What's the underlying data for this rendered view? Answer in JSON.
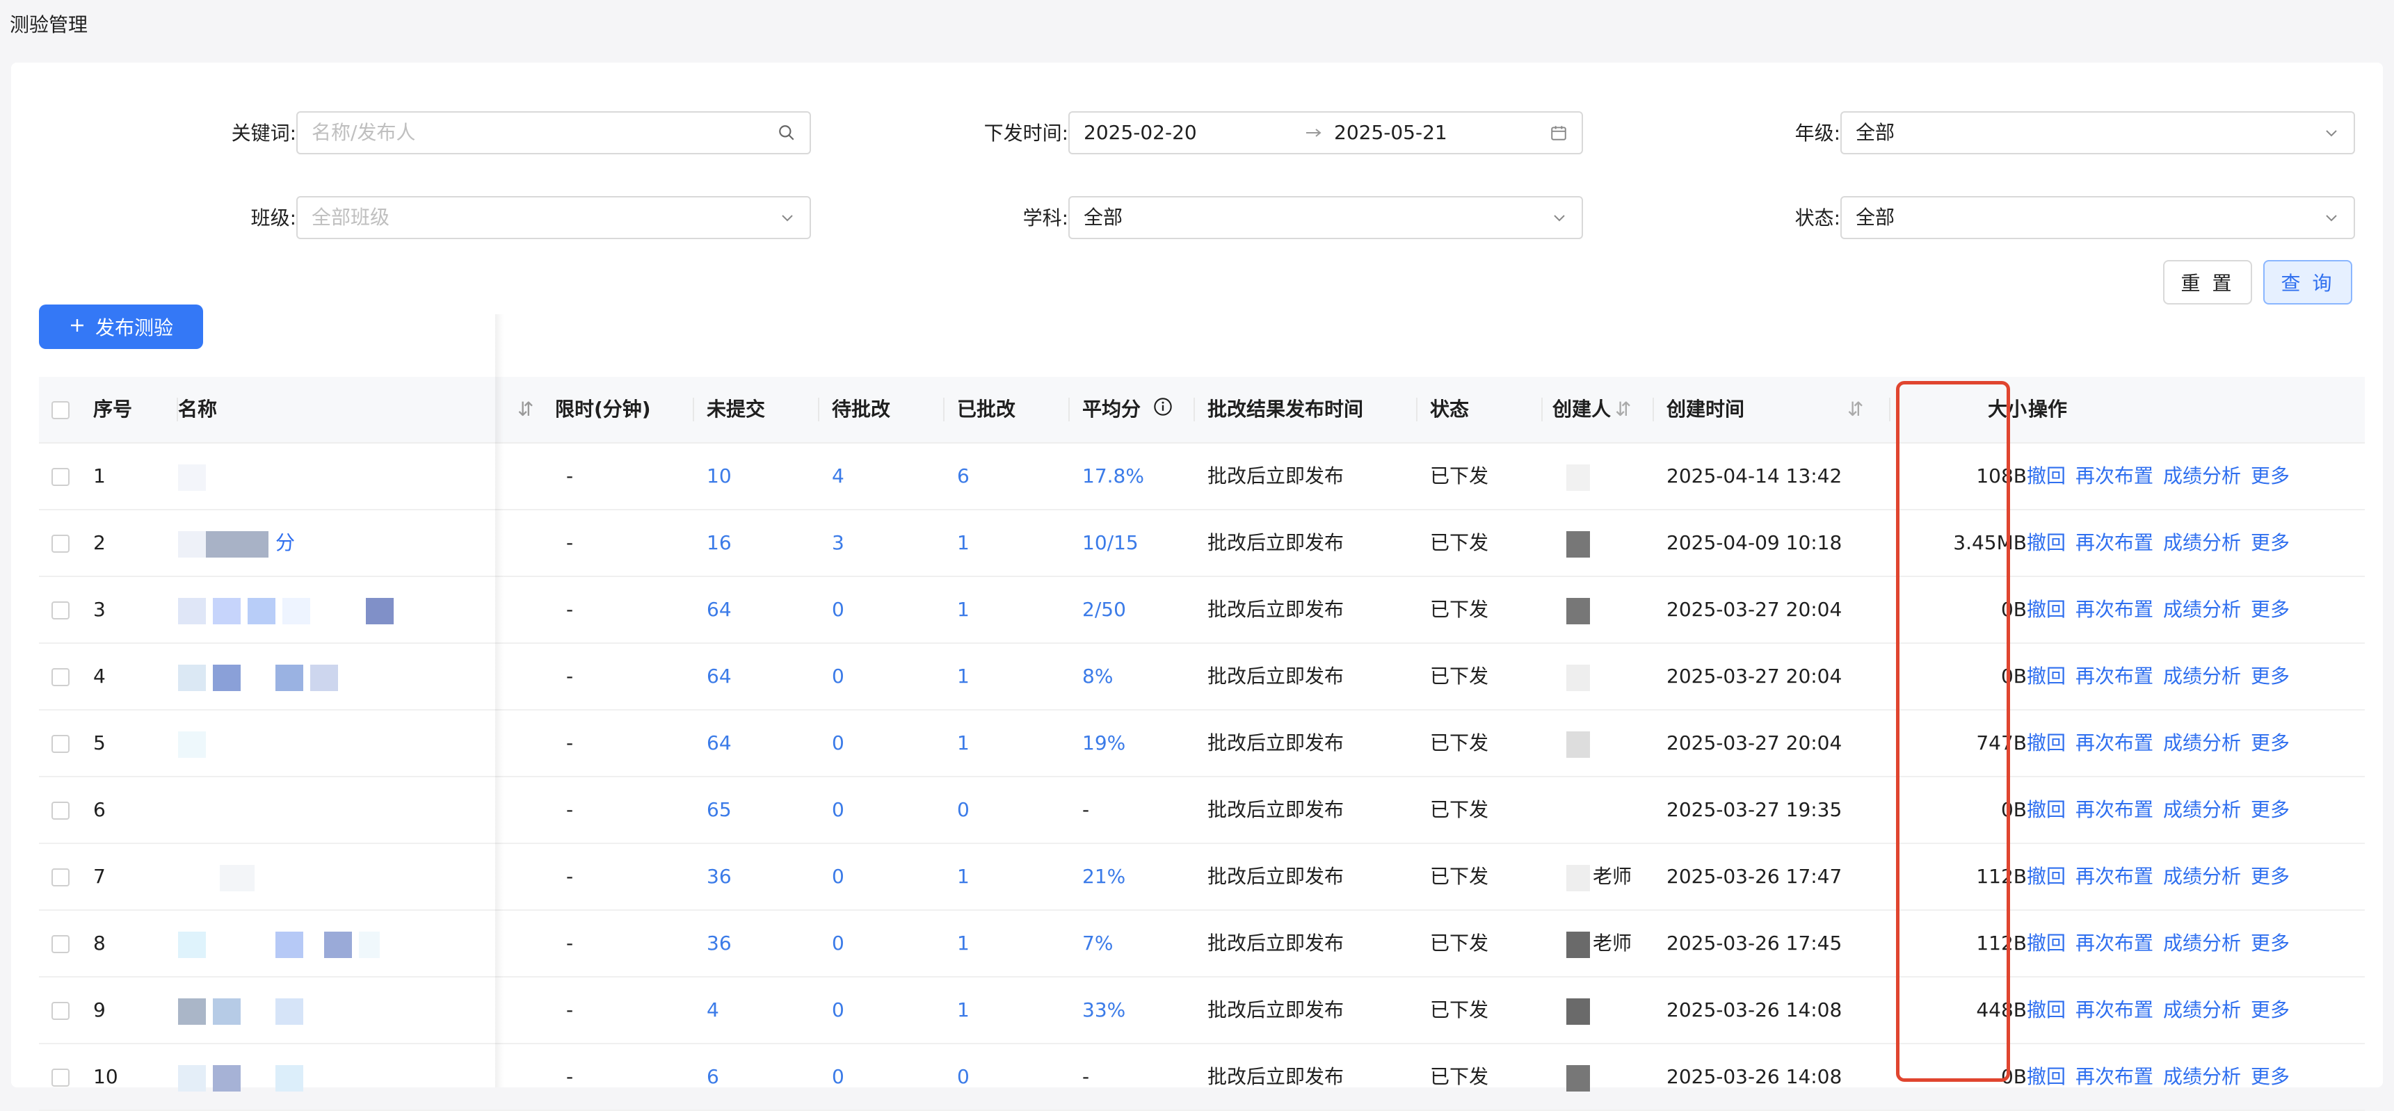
{
  "page": {
    "title": "测验管理"
  },
  "filters": {
    "keyword": {
      "label": "关键词:",
      "placeholder": "名称/发布人"
    },
    "date": {
      "label": "下发时间:",
      "start": "2025-02-20",
      "end": "2025-05-21"
    },
    "grade": {
      "label": "年级:",
      "value": "全部"
    },
    "class": {
      "label": "班级:",
      "placeholder": "全部班级"
    },
    "subject": {
      "label": "学科:",
      "value": "全部"
    },
    "status": {
      "label": "状态:",
      "value": "全部"
    }
  },
  "buttons": {
    "reset": "重 置",
    "query": "查 询",
    "publish": "发布测验"
  },
  "table": {
    "headers": {
      "index": "序号",
      "name": "名称",
      "time_limit": "限时(分钟)",
      "unsubmitted": "未提交",
      "pending": "待批改",
      "graded": "已批改",
      "avg_score": "平均分",
      "publish_time": "批改结果发布时间",
      "status": "状态",
      "creator": "创建人",
      "created_at": "创建时间",
      "size": "大小",
      "actions": "操作"
    },
    "rows": [
      {
        "index": "1",
        "name": "",
        "time_limit": "-",
        "unsubmitted": "10",
        "pending": "4",
        "graded": "6",
        "avg": "17.8%",
        "publish": "批改后立即发布",
        "status": "已下发",
        "creator": "",
        "created": "2025-04-14 13:42",
        "size": "108B"
      },
      {
        "index": "2",
        "name": "分",
        "time_limit": "-",
        "unsubmitted": "16",
        "pending": "3",
        "graded": "1",
        "avg": "10/15",
        "publish": "批改后立即发布",
        "status": "已下发",
        "creator": "",
        "created": "2025-04-09 10:18",
        "size": "3.45MB"
      },
      {
        "index": "3",
        "name": "",
        "time_limit": "-",
        "unsubmitted": "64",
        "pending": "0",
        "graded": "1",
        "avg": "2/50",
        "publish": "批改后立即发布",
        "status": "已下发",
        "creator": "",
        "created": "2025-03-27 20:04",
        "size": "0B"
      },
      {
        "index": "4",
        "name": "",
        "time_limit": "-",
        "unsubmitted": "64",
        "pending": "0",
        "graded": "1",
        "avg": "8%",
        "publish": "批改后立即发布",
        "status": "已下发",
        "creator": "",
        "created": "2025-03-27 20:04",
        "size": "0B"
      },
      {
        "index": "5",
        "name": "",
        "time_limit": "-",
        "unsubmitted": "64",
        "pending": "0",
        "graded": "1",
        "avg": "19%",
        "publish": "批改后立即发布",
        "status": "已下发",
        "creator": "",
        "created": "2025-03-27 20:04",
        "size": "747B"
      },
      {
        "index": "6",
        "name": "",
        "time_limit": "-",
        "unsubmitted": "65",
        "pending": "0",
        "graded": "0",
        "avg": "-",
        "publish": "批改后立即发布",
        "status": "已下发",
        "creator": "",
        "created": "2025-03-27 19:35",
        "size": "0B"
      },
      {
        "index": "7",
        "name": "",
        "time_limit": "-",
        "unsubmitted": "36",
        "pending": "0",
        "graded": "1",
        "avg": "21%",
        "publish": "批改后立即发布",
        "status": "已下发",
        "creator": "老师",
        "created": "2025-03-26 17:47",
        "size": "112B"
      },
      {
        "index": "8",
        "name": "",
        "time_limit": "-",
        "unsubmitted": "36",
        "pending": "0",
        "graded": "1",
        "avg": "7%",
        "publish": "批改后立即发布",
        "status": "已下发",
        "creator": "老师",
        "created": "2025-03-26 17:45",
        "size": "112B"
      },
      {
        "index": "9",
        "name": "",
        "time_limit": "-",
        "unsubmitted": "4",
        "pending": "0",
        "graded": "1",
        "avg": "33%",
        "publish": "批改后立即发布",
        "status": "已下发",
        "creator": "",
        "created": "2025-03-26 14:08",
        "size": "448B"
      },
      {
        "index": "10",
        "name": "",
        "time_limit": "-",
        "unsubmitted": "6",
        "pending": "0",
        "graded": "0",
        "avg": "-",
        "publish": "批改后立即发布",
        "status": "已下发",
        "creator": "",
        "created": "2025-03-26 14:08",
        "size": "0B"
      }
    ],
    "actions": [
      "撤回",
      "再次布置",
      "成绩分析",
      "更多"
    ]
  },
  "colors": {
    "accent": "#3478f6",
    "link": "#2f6fef",
    "highlight": "#e0452f"
  },
  "icons": {
    "search": "search-icon",
    "calendar": "calendar-icon",
    "dropdown": "chevron-down-icon",
    "plus": "plus-icon",
    "info": "info-circle-icon",
    "sort": "sort-icon"
  }
}
